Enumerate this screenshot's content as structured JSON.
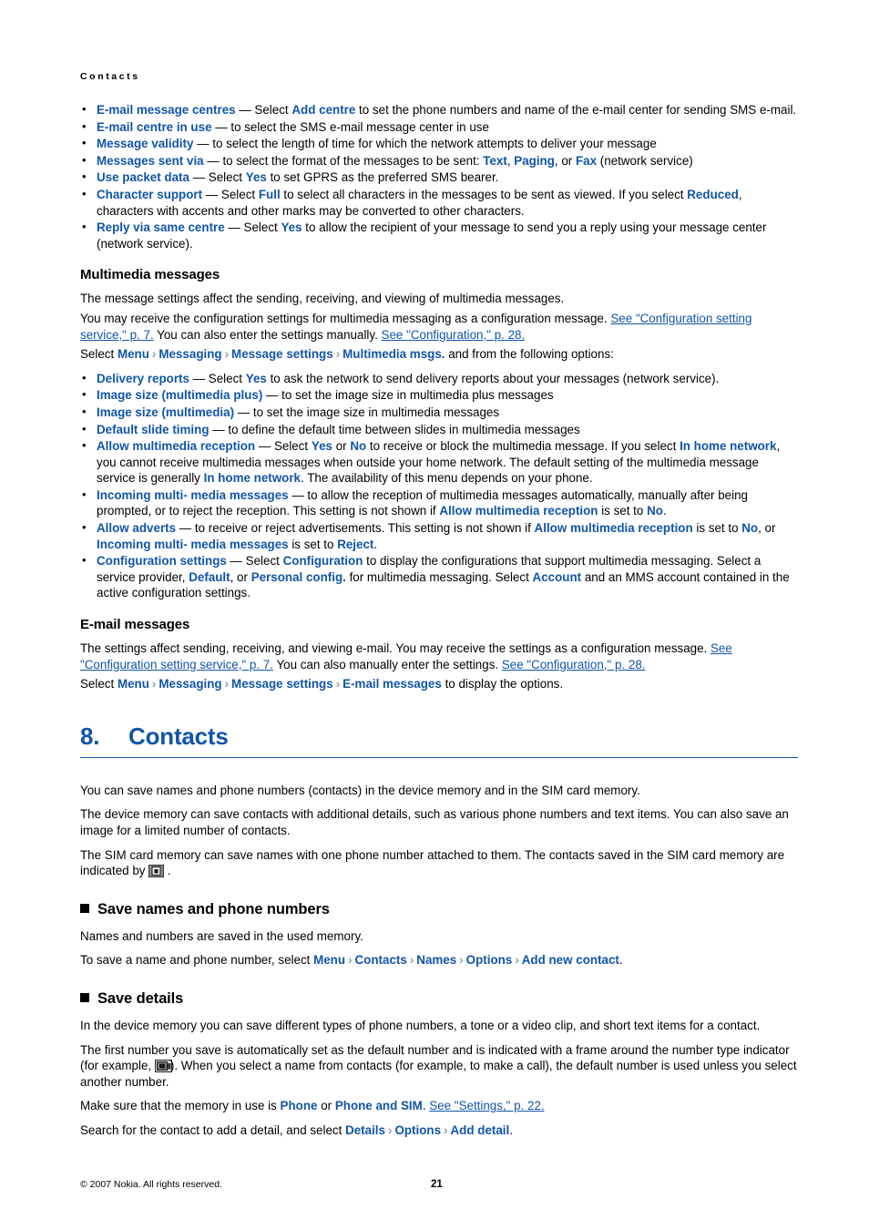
{
  "running_head": "Contacts",
  "sms_bullets": [
    {
      "id": "email-message-centres",
      "parts": [
        {
          "t": "E-mail message centres",
          "s": "b"
        },
        {
          "t": " — Select "
        },
        {
          "t": "Add centre",
          "s": "b"
        },
        {
          "t": " to set the phone numbers and name of the e-mail center for sending SMS e-mail."
        }
      ]
    },
    {
      "id": "email-centre-in-use",
      "parts": [
        {
          "t": "E-mail centre in use",
          "s": "b"
        },
        {
          "t": " — to select the SMS e-mail message center in use"
        }
      ]
    },
    {
      "id": "message-validity",
      "parts": [
        {
          "t": "Message validity",
          "s": "b"
        },
        {
          "t": " — to select the length of time for which the network attempts to deliver your message"
        }
      ]
    },
    {
      "id": "messages-sent-via",
      "parts": [
        {
          "t": "Messages sent via",
          "s": "b"
        },
        {
          "t": " — to select the format of the messages to be sent: "
        },
        {
          "t": "Text",
          "s": "b"
        },
        {
          "t": ", "
        },
        {
          "t": "Paging",
          "s": "b"
        },
        {
          "t": ", or "
        },
        {
          "t": "Fax",
          "s": "b"
        },
        {
          "t": " (network service)"
        }
      ]
    },
    {
      "id": "use-packet-data",
      "parts": [
        {
          "t": "Use packet data",
          "s": "b"
        },
        {
          "t": " — Select "
        },
        {
          "t": "Yes",
          "s": "b"
        },
        {
          "t": " to set GPRS as the preferred SMS bearer."
        }
      ]
    },
    {
      "id": "character-support",
      "parts": [
        {
          "t": "Character support",
          "s": "b"
        },
        {
          "t": " — Select "
        },
        {
          "t": "Full",
          "s": "b"
        },
        {
          "t": " to select all characters in the messages to be sent as viewed. If you select "
        },
        {
          "t": "Reduced",
          "s": "b"
        },
        {
          "t": ", characters with accents and other marks may be converted to other characters."
        }
      ]
    },
    {
      "id": "reply-via-same-centre",
      "parts": [
        {
          "t": "Reply via same centre",
          "s": "b"
        },
        {
          "t": " — Select "
        },
        {
          "t": "Yes",
          "s": "b"
        },
        {
          "t": " to allow the recipient of your message to send you a reply using your message center (network service)."
        }
      ]
    }
  ],
  "multimedia": {
    "heading": "Multimedia messages",
    "intro": "The message settings affect the sending, receiving, and viewing of multimedia messages.",
    "config_paragraph": [
      {
        "t": "You may receive the configuration settings for multimedia messaging as a configuration message. "
      },
      {
        "t": "See \"Configuration setting service,\" p. 7.",
        "s": "lnk"
      },
      {
        "t": " You can also enter the settings manually. "
      },
      {
        "t": "See \"Configuration,\" p. 28.",
        "s": "lnk"
      }
    ],
    "path": [
      {
        "t": "Select "
      },
      {
        "t": "Menu",
        "s": "b"
      },
      {
        "t": "›",
        "s": "sep"
      },
      {
        "t": "Messaging",
        "s": "b"
      },
      {
        "t": "›",
        "s": "sep"
      },
      {
        "t": "Message settings",
        "s": "b"
      },
      {
        "t": "›",
        "s": "sep"
      },
      {
        "t": "Multimedia msgs.",
        "s": "b"
      },
      {
        "t": " and from the following options:"
      }
    ],
    "bullets": [
      {
        "id": "delivery-reports",
        "parts": [
          {
            "t": "Delivery reports",
            "s": "b"
          },
          {
            "t": " — Select "
          },
          {
            "t": "Yes",
            "s": "b"
          },
          {
            "t": " to ask the network to send delivery reports about your messages (network service)."
          }
        ]
      },
      {
        "id": "image-size-multimedia-plus",
        "parts": [
          {
            "t": "Image size (multimedia plus)",
            "s": "b"
          },
          {
            "t": " — to set the image size in multimedia plus messages"
          }
        ]
      },
      {
        "id": "image-size-multimedia",
        "parts": [
          {
            "t": "Image size (multimedia)",
            "s": "b"
          },
          {
            "t": " — to set the image size in multimedia messages"
          }
        ]
      },
      {
        "id": "default-slide-timing",
        "parts": [
          {
            "t": "Default slide timing",
            "s": "b"
          },
          {
            "t": " — to define the default time between slides in multimedia messages"
          }
        ]
      },
      {
        "id": "allow-multimedia-reception",
        "parts": [
          {
            "t": "Allow multimedia reception",
            "s": "b"
          },
          {
            "t": " — Select "
          },
          {
            "t": "Yes",
            "s": "b"
          },
          {
            "t": " or "
          },
          {
            "t": "No",
            "s": "b"
          },
          {
            "t": " to receive or block the multimedia message. If you select "
          },
          {
            "t": "In home network",
            "s": "b"
          },
          {
            "t": ", you cannot receive multimedia messages when outside your home network. The default setting of the multimedia message service is generally "
          },
          {
            "t": "In home network",
            "s": "b"
          },
          {
            "t": ". The availability of this menu depends on your phone."
          }
        ]
      },
      {
        "id": "incoming-multi-media-messages",
        "parts": [
          {
            "t": "Incoming multi- media messages",
            "s": "b"
          },
          {
            "t": " — to allow the reception of multimedia messages automatically, manually after being prompted, or to reject the reception. This setting is not shown if "
          },
          {
            "t": "Allow multimedia reception",
            "s": "b"
          },
          {
            "t": " is set to "
          },
          {
            "t": "No",
            "s": "b"
          },
          {
            "t": "."
          }
        ]
      },
      {
        "id": "allow-adverts",
        "parts": [
          {
            "t": "Allow adverts",
            "s": "b"
          },
          {
            "t": " — to receive or reject advertisements. This setting is not shown if "
          },
          {
            "t": "Allow multimedia reception",
            "s": "b"
          },
          {
            "t": " is set to "
          },
          {
            "t": "No",
            "s": "b"
          },
          {
            "t": ", or "
          },
          {
            "t": "Incoming multi- media messages",
            "s": "b"
          },
          {
            "t": " is set to "
          },
          {
            "t": "Reject",
            "s": "b"
          },
          {
            "t": "."
          }
        ]
      },
      {
        "id": "configuration-settings",
        "parts": [
          {
            "t": "Configuration settings",
            "s": "b"
          },
          {
            "t": " — Select "
          },
          {
            "t": "Configuration",
            "s": "b"
          },
          {
            "t": " to display the configurations that support multimedia messaging. Select a service provider, "
          },
          {
            "t": "Default",
            "s": "b"
          },
          {
            "t": ", or "
          },
          {
            "t": "Personal config.",
            "s": "b"
          },
          {
            "t": " for multimedia messaging. Select "
          },
          {
            "t": "Account",
            "s": "b"
          },
          {
            "t": " and an MMS account contained in the active configuration settings."
          }
        ]
      }
    ]
  },
  "email": {
    "heading": "E-mail messages",
    "intro": [
      {
        "t": "The settings affect sending, receiving, and viewing e-mail. You may receive the settings as a configuration message. "
      },
      {
        "t": "See \"Configuration setting service,\" p. 7.",
        "s": "lnk"
      },
      {
        "t": " You can also manually enter the settings. "
      },
      {
        "t": "See \"Configuration,\" p. 28.",
        "s": "lnk"
      }
    ],
    "path": [
      {
        "t": "Select "
      },
      {
        "t": "Menu",
        "s": "b"
      },
      {
        "t": "›",
        "s": "sep"
      },
      {
        "t": "Messaging",
        "s": "b"
      },
      {
        "t": "›",
        "s": "sep"
      },
      {
        "t": "Message settings",
        "s": "b"
      },
      {
        "t": "›",
        "s": "sep"
      },
      {
        "t": "E-mail messages",
        "s": "b"
      },
      {
        "t": " to display the options."
      }
    ]
  },
  "chapter": {
    "number": "8.",
    "title": "Contacts",
    "p1": "You can save names and phone numbers (contacts) in the device memory and in the SIM card memory.",
    "p2": "The device memory can save contacts with additional details, such as various phone numbers and text items. You can also save an image for a limited number of contacts.",
    "p3_before": "The SIM card memory can save names with one phone number attached to them. The contacts saved in the SIM card memory are indicated by ",
    "p3_after": " ."
  },
  "save_names": {
    "heading": "Save names and phone numbers",
    "p1": "Names and numbers are saved in the used memory.",
    "path": [
      {
        "t": "To save a name and phone number, select "
      },
      {
        "t": "Menu",
        "s": "b"
      },
      {
        "t": "›",
        "s": "sep"
      },
      {
        "t": "Contacts",
        "s": "b"
      },
      {
        "t": "›",
        "s": "sep"
      },
      {
        "t": "Names",
        "s": "b"
      },
      {
        "t": "›",
        "s": "sep"
      },
      {
        "t": "Options",
        "s": "b"
      },
      {
        "t": "›",
        "s": "sep"
      },
      {
        "t": "Add new contact",
        "s": "b"
      },
      {
        "t": "."
      }
    ]
  },
  "save_details": {
    "heading": "Save details",
    "p1": "In the device memory you can save different types of phone numbers, a tone or a video clip, and short text items for a contact.",
    "p2_before": "The first number you save is automatically set as the default number and is indicated with a frame around the number type indicator (for example, ",
    "p2_after": "). When you select a name from contacts (for example, to make a call), the default number is used unless you select another number.",
    "p3": [
      {
        "t": "Make sure that the memory in use is "
      },
      {
        "t": "Phone",
        "s": "b"
      },
      {
        "t": " or "
      },
      {
        "t": "Phone and SIM",
        "s": "b"
      },
      {
        "t": ". "
      },
      {
        "t": "See \"Settings,\" p. 22.",
        "s": "lnk"
      }
    ],
    "p4": [
      {
        "t": "Search for the contact to add a detail, and select "
      },
      {
        "t": "Details",
        "s": "b"
      },
      {
        "t": "›",
        "s": "sep"
      },
      {
        "t": "Options",
        "s": "b"
      },
      {
        "t": "›",
        "s": "sep"
      },
      {
        "t": "Add detail",
        "s": "b"
      },
      {
        "t": "."
      }
    ]
  },
  "footer": {
    "copyright": "© 2007 Nokia. All rights reserved.",
    "page_number": "21"
  },
  "colors": {
    "link_blue": "#1155a8",
    "separator_gray": "#7a7a7a"
  }
}
